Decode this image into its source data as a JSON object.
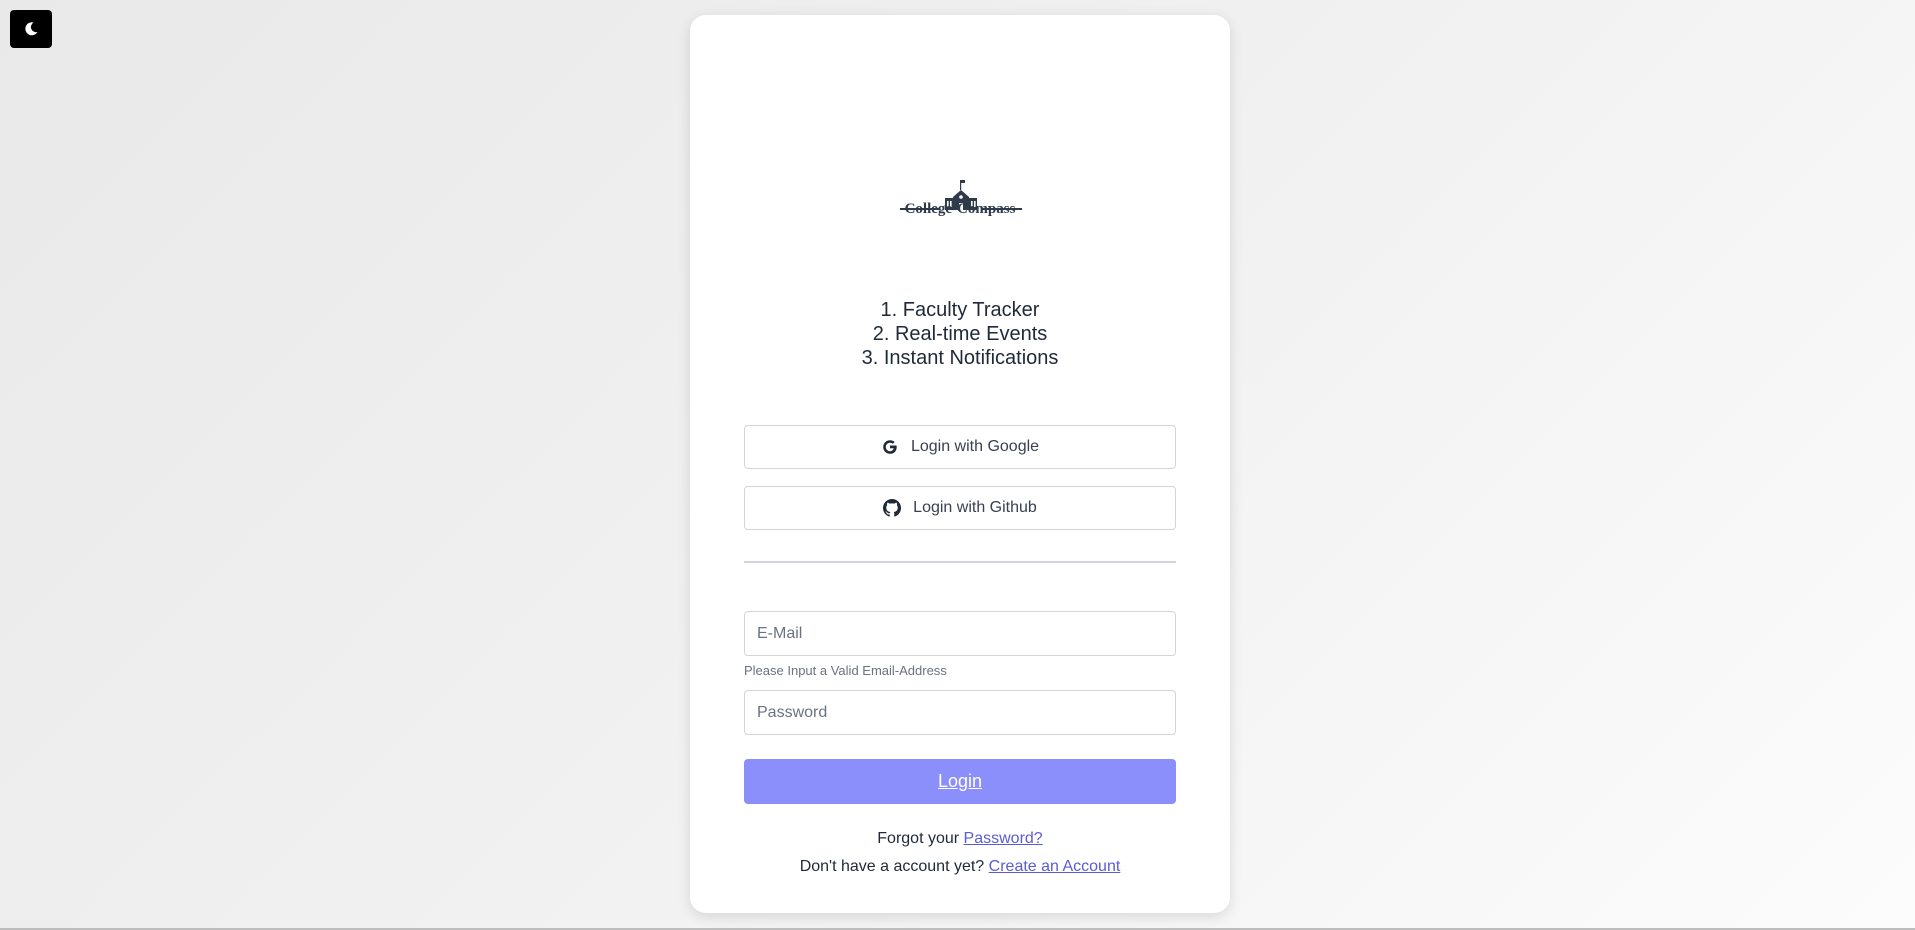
{
  "theme_toggle": {
    "icon": "moon-icon"
  },
  "logo": {
    "text": "College-Compass",
    "icon": "school-building-icon",
    "color": "#2f3a4a"
  },
  "features": [
    "1. Faculty Tracker",
    "2. Real-time Events",
    "3. Instant Notifications"
  ],
  "oauth": {
    "google": {
      "label": "Login with Google",
      "icon": "google-icon"
    },
    "github": {
      "label": "Login with Github",
      "icon": "github-icon"
    }
  },
  "form": {
    "email": {
      "placeholder": "E-Mail",
      "value": ""
    },
    "email_hint": "Please Input a Valid Email-Address",
    "password": {
      "placeholder": "Password",
      "value": ""
    },
    "login_label": "Login"
  },
  "footer": {
    "forgot_text": "Forgot your",
    "forgot_link": "Password?",
    "signup_text": "Don't have a account yet?",
    "signup_link": "Create an Account"
  },
  "colors": {
    "accent": "#8b8ffc",
    "link": "#5b5bd6",
    "toggle_bg": "#000000"
  }
}
